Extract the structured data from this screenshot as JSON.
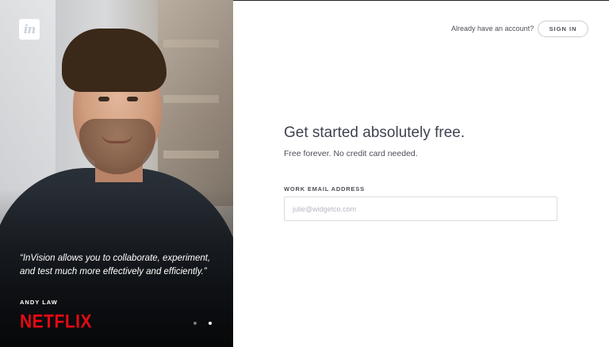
{
  "hero": {
    "logo_text": "in",
    "quote": "“InVision allows you to collaborate, experiment, and test much more effectively and efficiently.”",
    "author": "ANDY LAW",
    "company": "NETFLIX",
    "company_color": "#e50914",
    "carousel": {
      "total": 2,
      "active_index": 1
    }
  },
  "header": {
    "account_prompt": "Already have an account?",
    "signin_label": "SIGN IN"
  },
  "form": {
    "headline": "Get started absolutely free.",
    "subtext": "Free forever. No credit card needed.",
    "email_label": "WORK EMAIL ADDRESS",
    "email_placeholder": "julie@widgetco.com",
    "email_value": ""
  },
  "icons": [
    "invision-logo-icon"
  ]
}
